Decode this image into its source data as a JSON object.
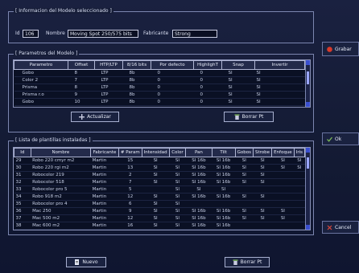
{
  "model_group": {
    "title": "[ Informacion del Modelo seleccionado ]",
    "id_label": "Id",
    "id_value": "106",
    "name_label": "Nombre",
    "name_value": "Moving Spot 250/575 bits",
    "maker_label": "Fabricante",
    "maker_value": "Strong"
  },
  "params_group": {
    "title": "[ Parametros del Modelo ]",
    "columns": [
      "Parametro",
      "Offset",
      "HTP/LTP",
      "8/16 bits",
      "Por defecto",
      "HighlighT",
      "Snap",
      "Invertir"
    ],
    "rows": [
      [
        "Gobo",
        "8",
        "LTP",
        "8b",
        "0",
        "0",
        "SI",
        "SI"
      ],
      [
        "Color 2",
        "7",
        "LTP",
        "8b",
        "0",
        "0",
        "SI",
        "SI"
      ],
      [
        "Prisma",
        "8",
        "LTP",
        "8b",
        "0",
        "0",
        "SI",
        "SI"
      ],
      [
        "Prisma r.o",
        "9",
        "LTP",
        "8b",
        "0",
        "0",
        "SI",
        "SI"
      ],
      [
        "Gobo",
        "10",
        "LTP",
        "8b",
        "0",
        "0",
        "SI",
        "SI"
      ]
    ],
    "btn_update": "Actualizar",
    "btn_delete": "Borrar Pt"
  },
  "fixtures_group": {
    "title": "[ Lista de plantillas instaladas ]",
    "columns": [
      "Id",
      "Nombre",
      "Fabricante",
      "# Param",
      "Intensidad",
      "Color",
      "Pan",
      "Tilt",
      "Gobos",
      "Strobe",
      "Enfoque",
      "Iris"
    ],
    "rows": [
      [
        "29",
        "Robo 220 cmyr m2",
        "Martin",
        "15",
        "SI",
        "SI",
        "SI 16b",
        "SI 16b",
        "SI",
        "SI",
        "SI",
        "SI"
      ],
      [
        "30",
        "Robo 220 rgi m2",
        "Martin",
        "13",
        "SI",
        "SI",
        "SI 16b",
        "SI 16b",
        "SI",
        "SI",
        "SI",
        "SI"
      ],
      [
        "31",
        "Robocolor 219",
        "Martin",
        "2",
        "SI",
        "SI",
        "SI 16b",
        "SI 16b",
        "SI",
        "SI",
        "",
        ""
      ],
      [
        "32",
        "Robocolor 518",
        "Martin",
        "7",
        "SI",
        "SI",
        "SI 16b",
        "SI 16b",
        "SI",
        "SI",
        "",
        ""
      ],
      [
        "33",
        "Robocolor pro 5",
        "Martin",
        "5",
        "",
        "SI",
        "SI",
        "SI",
        "",
        "",
        "",
        ""
      ],
      [
        "34",
        "Robo 918 m2",
        "Martin",
        "12",
        "SI",
        "SI",
        "SI 16b",
        "SI 16b",
        "SI",
        "SI",
        "",
        ""
      ],
      [
        "35",
        "Robocolor pro 4",
        "Martin",
        "6",
        "SI",
        "SI",
        "",
        "",
        "",
        "",
        "",
        ""
      ],
      [
        "36",
        "Mac 250",
        "Martin",
        "9",
        "SI",
        "SI",
        "SI 16b",
        "SI 16b",
        "SI",
        "SI",
        "SI",
        ""
      ],
      [
        "37",
        "Mac 500 m2",
        "Martin",
        "12",
        "SI",
        "SI",
        "SI 16b",
        "SI 16b",
        "SI",
        "SI",
        "SI",
        ""
      ],
      [
        "38",
        "Mac 600 m2",
        "Martin",
        "16",
        "SI",
        "SI",
        "SI 16b",
        "SI 16b",
        "",
        "",
        "",
        ""
      ]
    ],
    "btn_new": "Nuevo",
    "btn_delete": "Borrar Pt"
  },
  "side": {
    "save": "Grabar",
    "ok": "Ok",
    "cancel": "Cancel"
  },
  "colors": {
    "accent": "#3a4fcf",
    "save_icon": "#d83a2a"
  }
}
